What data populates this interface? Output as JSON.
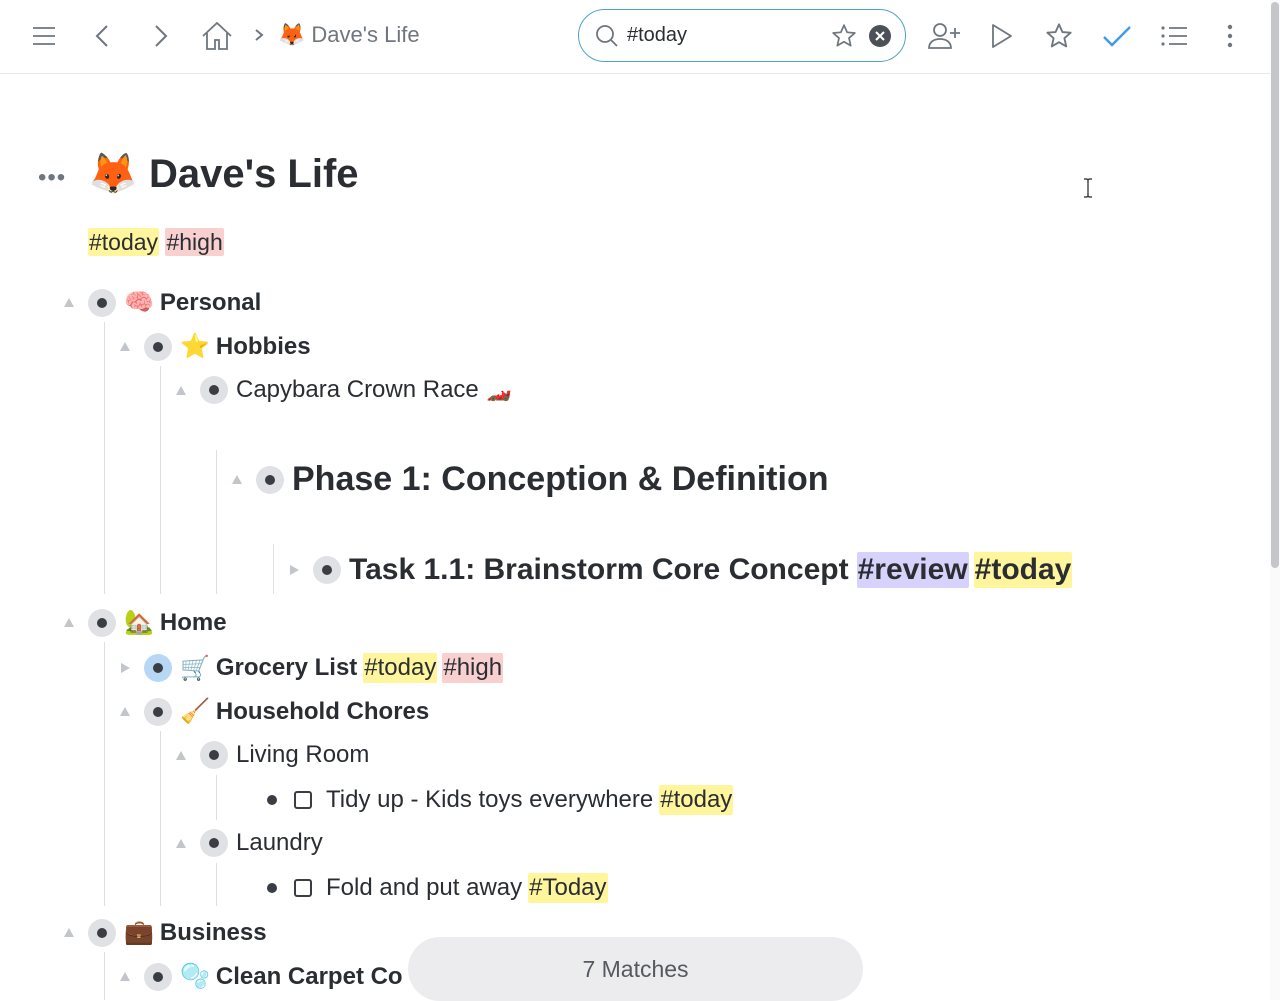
{
  "toolbar": {
    "breadcrumb_emoji": "🦊",
    "breadcrumb_title": "Dave's Life",
    "search_value": "#today",
    "accent_color": "#4fa3c8"
  },
  "document": {
    "title_emoji": "🦊",
    "title": "Dave's Life",
    "tags": [
      "#today",
      "#high"
    ],
    "more_menu": "•••"
  },
  "tree": {
    "personal": {
      "emoji": "🧠",
      "label": "Personal"
    },
    "hobbies": {
      "emoji": "⭐",
      "label": "Hobbies"
    },
    "capybara": {
      "label": "Capybara Crown Race",
      "emoji": "🏎️"
    },
    "phase1": {
      "label": "Phase 1: Conception & Definition"
    },
    "task11": {
      "label": "Task 1.1: Brainstorm Core Concept",
      "tags": [
        "#review",
        "#today"
      ]
    },
    "home": {
      "emoji": "🏡",
      "label": "Home"
    },
    "grocery": {
      "emoji": "🛒",
      "label": "Grocery List",
      "tags": [
        "#today",
        "#high"
      ]
    },
    "chores": {
      "emoji": "🧹",
      "label": "Household Chores"
    },
    "living_room": {
      "label": "Living Room"
    },
    "tidy": {
      "label": "Tidy up - Kids toys everywhere",
      "tag": "#today"
    },
    "laundry": {
      "label": "Laundry"
    },
    "fold": {
      "label": "Fold and put away",
      "tag": "#Today"
    },
    "business": {
      "emoji": "💼",
      "label": "Business"
    },
    "carpet": {
      "emoji": "🫧",
      "label": "Clean Carpet Co"
    }
  },
  "status": {
    "matches": "7 Matches"
  },
  "colors": {
    "today": "#fff59d",
    "high": "#f8d0d0",
    "review": "#d7d2fb"
  }
}
